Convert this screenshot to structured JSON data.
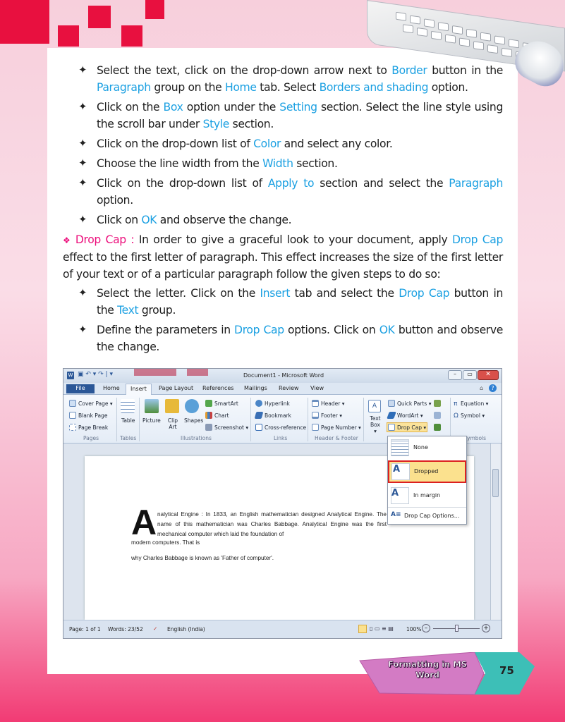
{
  "steps_a": [
    {
      "parts": [
        [
          "Select the text, click on the drop-down arrow next to ",
          0
        ],
        [
          "Border",
          1
        ],
        [
          " button in the ",
          0
        ],
        [
          "Paragraph",
          1
        ],
        [
          " group on the ",
          0
        ],
        [
          "Home",
          1
        ],
        [
          " tab. Select ",
          0
        ],
        [
          "Borders and shading",
          1
        ],
        [
          " option.",
          0
        ]
      ]
    },
    {
      "parts": [
        [
          "Click on the ",
          0
        ],
        [
          "Box",
          1
        ],
        [
          " option under the ",
          0
        ],
        [
          "Setting",
          1
        ],
        [
          " section. Select the line style using the scroll bar under ",
          0
        ],
        [
          "Style",
          1
        ],
        [
          " section.",
          0
        ]
      ]
    },
    {
      "parts": [
        [
          "Click on the drop-down list of ",
          0
        ],
        [
          "Color",
          1
        ],
        [
          " and select any color.",
          0
        ]
      ]
    },
    {
      "parts": [
        [
          "Choose the line width from the ",
          0
        ],
        [
          "Width",
          1
        ],
        [
          " section.",
          0
        ]
      ]
    },
    {
      "parts": [
        [
          "Click on the drop-down list of ",
          0
        ],
        [
          "Apply to",
          1
        ],
        [
          " section and select the ",
          0
        ],
        [
          "Paragraph",
          1
        ],
        [
          " option.",
          0
        ]
      ]
    },
    {
      "parts": [
        [
          "Click on ",
          0
        ],
        [
          "OK",
          1
        ],
        [
          " and observe the change.",
          0
        ]
      ]
    }
  ],
  "dropcap": {
    "diamond": "❖",
    "title": "Drop Cap :",
    "text": " In order to give a graceful look to your document, apply ",
    "link": "Drop Cap",
    "text2": " effect to the first letter of paragraph. This effect increases the size of the first letter of your text or of a particular paragraph follow the given steps to do so:"
  },
  "steps_b": [
    {
      "parts": [
        [
          "Select the letter. Click on the ",
          0
        ],
        [
          "Insert",
          1
        ],
        [
          " tab and select the ",
          0
        ],
        [
          "Drop Cap",
          1
        ],
        [
          " button in the ",
          0
        ],
        [
          "Text",
          1
        ],
        [
          " group.",
          0
        ]
      ]
    },
    {
      "parts": [
        [
          "Define the parameters in ",
          0
        ],
        [
          "Drop Cap",
          1
        ],
        [
          " options. Click on ",
          0
        ],
        [
          "OK",
          1
        ],
        [
          " button and observe the change.",
          0
        ]
      ]
    }
  ],
  "bullet": "✦",
  "word": {
    "title": "Document1 - Microsoft Word",
    "tabs": [
      "File",
      "Home",
      "Insert",
      "Page Layout",
      "References",
      "Mailings",
      "Review",
      "View"
    ],
    "pages": [
      "Cover Page ▾",
      "Blank Page",
      "Page Break"
    ],
    "table": "Table",
    "illus": [
      "Picture",
      "Clip Art",
      "Shapes"
    ],
    "illus2": [
      "SmartArt",
      "Chart",
      "Screenshot ▾"
    ],
    "links": [
      "Hyperlink",
      "Bookmark",
      "Cross-reference"
    ],
    "hf": [
      "Header ▾",
      "Footer ▾",
      "Page Number ▾"
    ],
    "textbox": "Text Box ▾",
    "text_grp": [
      "Quick Parts ▾",
      "WordArt ▾",
      "Drop Cap ▾"
    ],
    "symbols": [
      "Equation ▾",
      "Symbol ▾"
    ],
    "groups": [
      "Pages",
      "Tables",
      "Illustrations",
      "Links",
      "Header & Footer",
      "ymbols"
    ],
    "dropdown": [
      "None",
      "Dropped",
      "In margin",
      "Drop Cap Options..."
    ],
    "doc_cap": "A",
    "doc_text": "nalytical Engine : In 1833, an English mathematician designed Analytical Engine. The name of this mathematician was Charles Babbage. Analytical Engine was the first mechanical computer which laid the foundation of",
    "doc_text2": "modern computers. That is",
    "doc_text3": "why Charles Babbage is known as 'Father of computer'.",
    "status": {
      "page": "Page: 1 of 1",
      "words": "Words: 23/52",
      "lang": "English (India)",
      "zoom": "100%"
    }
  },
  "footer": {
    "chapter": "Formatting in MS Word",
    "page": "75"
  },
  "colors": {
    "highlight": "#1ba0e2",
    "pink": "#ec0f7c",
    "accent_red": "#e8103f"
  }
}
